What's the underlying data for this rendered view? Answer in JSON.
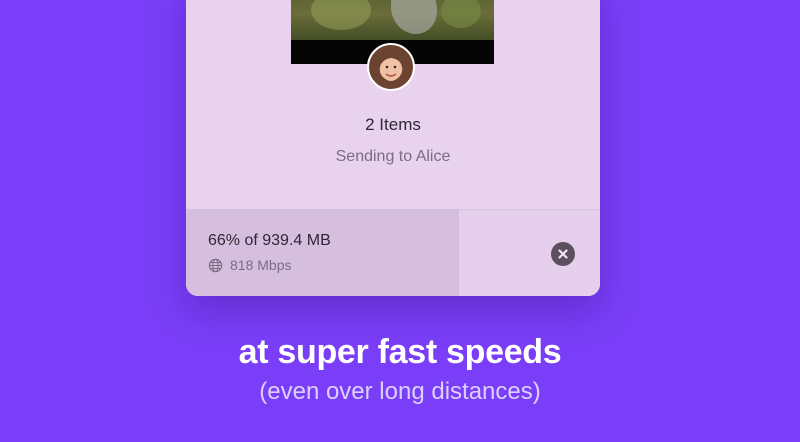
{
  "transfer_card": {
    "items_count": "2 Items",
    "recipient_text": "Sending to Alice",
    "progress_text": "66% of 939.4 MB",
    "progress_percent": 66,
    "speed_text": "818 Mbps",
    "speed_icon": "globe-icon",
    "cancel_icon": "close-icon"
  },
  "caption": {
    "headline": "at super fast speeds",
    "subheadline": "(even over long distances)"
  },
  "colors": {
    "background": "#7a3ef8",
    "card": "#e8d2ee",
    "progress_fill": "#d6bfde"
  }
}
